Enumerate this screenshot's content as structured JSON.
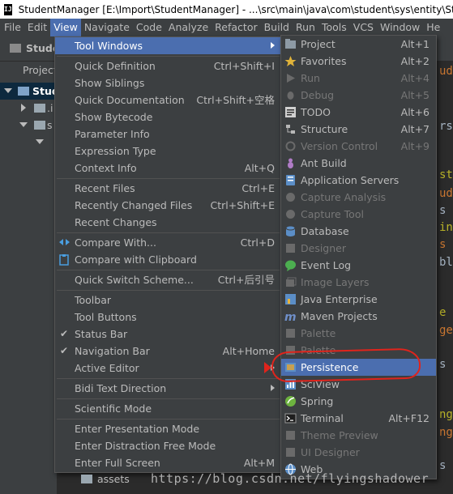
{
  "window": {
    "title": "StudentManager [E:\\Import\\StudentManager] - ...\\src\\main\\java\\com\\student\\sys\\entity\\Stu",
    "logo": "IJ"
  },
  "menubar": [
    {
      "label": "File"
    },
    {
      "label": "Edit"
    },
    {
      "label": "View",
      "active": true
    },
    {
      "label": "Navigate"
    },
    {
      "label": "Code"
    },
    {
      "label": "Analyze"
    },
    {
      "label": "Refactor"
    },
    {
      "label": "Build"
    },
    {
      "label": "Run"
    },
    {
      "label": "Tools"
    },
    {
      "label": "VCS"
    },
    {
      "label": "Window"
    },
    {
      "label": "He"
    }
  ],
  "background": {
    "breadcrumb": "Studen",
    "project_tab": "Project",
    "tree_selected": "Stud",
    "tree_items": [
      ".i",
      "s"
    ],
    "bottom_folder": "assets",
    "editor_fragments": [
      "ude",
      "rs",
      "st",
      "ud",
      "s",
      "in",
      "s",
      "bl",
      "e",
      "ge",
      "s",
      "ng",
      "ng",
      "s"
    ]
  },
  "view_menu": [
    {
      "label": "Tool Windows",
      "submenu": true,
      "highlighted": true
    },
    {
      "separator": true
    },
    {
      "label": "Quick Definition",
      "shortcut": "Ctrl+Shift+I"
    },
    {
      "label": "Show Siblings",
      "shortcut": ""
    },
    {
      "label": "Quick Documentation",
      "shortcut": "Ctrl+Shift+空格"
    },
    {
      "label": "Show Bytecode",
      "shortcut": ""
    },
    {
      "label": "Parameter Info",
      "shortcut": ""
    },
    {
      "label": "Expression Type",
      "shortcut": ""
    },
    {
      "label": "Context Info",
      "shortcut": "Alt+Q"
    },
    {
      "separator": true
    },
    {
      "label": "Recent Files",
      "shortcut": "Ctrl+E"
    },
    {
      "label": "Recently Changed Files",
      "shortcut": "Ctrl+Shift+E"
    },
    {
      "label": "Recent Changes",
      "shortcut": ""
    },
    {
      "separator": true
    },
    {
      "label": "Compare With...",
      "shortcut": "Ctrl+D",
      "icon": "compare-icon"
    },
    {
      "label": "Compare with Clipboard",
      "shortcut": "",
      "icon": "clipboard-compare-icon"
    },
    {
      "separator": true
    },
    {
      "label": "Quick Switch Scheme...",
      "shortcut": "Ctrl+后引号"
    },
    {
      "separator": true
    },
    {
      "label": "Toolbar",
      "shortcut": ""
    },
    {
      "label": "Tool Buttons",
      "shortcut": ""
    },
    {
      "label": "Status Bar",
      "shortcut": "",
      "checked": true
    },
    {
      "label": "Navigation Bar",
      "shortcut": "Alt+Home",
      "checked": true
    },
    {
      "label": "Active Editor",
      "submenu": true
    },
    {
      "separator": true
    },
    {
      "label": "Bidi Text Direction",
      "submenu": true
    },
    {
      "separator": true
    },
    {
      "label": "Scientific Mode",
      "shortcut": ""
    },
    {
      "separator": true
    },
    {
      "label": "Enter Presentation Mode",
      "shortcut": ""
    },
    {
      "label": "Enter Distraction Free Mode",
      "shortcut": ""
    },
    {
      "label": "Enter Full Screen",
      "shortcut": "Alt+M"
    }
  ],
  "tool_windows_menu": [
    {
      "label": "Project",
      "shortcut": "Alt+1",
      "icon": "project-icon",
      "color": "#8d9aa5"
    },
    {
      "label": "Favorites",
      "shortcut": "Alt+2",
      "icon": "star-icon",
      "color": "#e0b33a"
    },
    {
      "label": "Run",
      "shortcut": "Alt+4",
      "icon": "run-icon",
      "disabled": true,
      "color": "#6a6a6a"
    },
    {
      "label": "Debug",
      "shortcut": "Alt+5",
      "icon": "debug-icon",
      "disabled": true,
      "color": "#6a6a6a"
    },
    {
      "label": "TODO",
      "shortcut": "Alt+6",
      "icon": "todo-icon",
      "color": "#d0d0d0"
    },
    {
      "label": "Structure",
      "shortcut": "Alt+7",
      "icon": "structure-icon",
      "color": "#b7b7b7"
    },
    {
      "label": "Version Control",
      "shortcut": "Alt+9",
      "icon": "vcs-icon",
      "disabled": true,
      "color": "#6a6a6a"
    },
    {
      "label": "Ant Build",
      "shortcut": "",
      "icon": "ant-icon",
      "color": "#b07cc6"
    },
    {
      "label": "Application Servers",
      "shortcut": "",
      "icon": "servers-icon",
      "color": "#5b8ec7"
    },
    {
      "label": "Capture Analysis",
      "shortcut": "",
      "icon": "capture-analysis-icon",
      "disabled": true,
      "color": "#6a6a6a"
    },
    {
      "label": "Capture Tool",
      "shortcut": "",
      "icon": "capture-tool-icon",
      "disabled": true,
      "color": "#6a6a6a"
    },
    {
      "label": "Database",
      "shortcut": "",
      "icon": "database-icon",
      "color": "#5b8ec7"
    },
    {
      "label": "Designer",
      "shortcut": "",
      "icon": "designer-icon",
      "disabled": true,
      "color": "#6a6a6a"
    },
    {
      "label": "Event Log",
      "shortcut": "",
      "icon": "event-log-icon",
      "color": "#4caf50"
    },
    {
      "label": "Image Layers",
      "shortcut": "",
      "icon": "image-layers-icon",
      "disabled": true,
      "color": "#6a6a6a"
    },
    {
      "label": "Java Enterprise",
      "shortcut": "",
      "icon": "java-enterprise-icon",
      "color": "#5b8ec7"
    },
    {
      "label": "Maven Projects",
      "shortcut": "",
      "icon": "maven-icon",
      "color": "#6f8fc9"
    },
    {
      "label": "Palette",
      "shortcut": "",
      "icon": "palette-icon",
      "disabled": true,
      "color": "#6a6a6a"
    },
    {
      "label": "Palette\t",
      "shortcut": "",
      "icon": "palette-icon",
      "disabled": true,
      "color": "#6a6a6a"
    },
    {
      "label": "Persistence",
      "shortcut": "",
      "icon": "persistence-icon",
      "highlighted": true,
      "color": "#c8a050"
    },
    {
      "label": "SciView",
      "shortcut": "",
      "icon": "sciview-icon",
      "color": "#5b8ec7"
    },
    {
      "label": "Spring",
      "shortcut": "",
      "icon": "spring-icon",
      "color": "#6db33f"
    },
    {
      "label": "Terminal",
      "shortcut": "Alt+F12",
      "icon": "terminal-icon",
      "color": "#1e1e1e"
    },
    {
      "label": "Theme Preview",
      "shortcut": "",
      "icon": "theme-preview-icon",
      "disabled": true,
      "color": "#6a6a6a"
    },
    {
      "label": "UI Designer",
      "shortcut": "",
      "icon": "ui-designer-icon",
      "disabled": true,
      "color": "#6a6a6a"
    },
    {
      "label": "Web",
      "shortcut": "",
      "icon": "web-icon",
      "color": "#5b8ec7"
    }
  ],
  "watermark": "https://blog.csdn.net/flyingshadower",
  "annotation_color": "#e0241c"
}
